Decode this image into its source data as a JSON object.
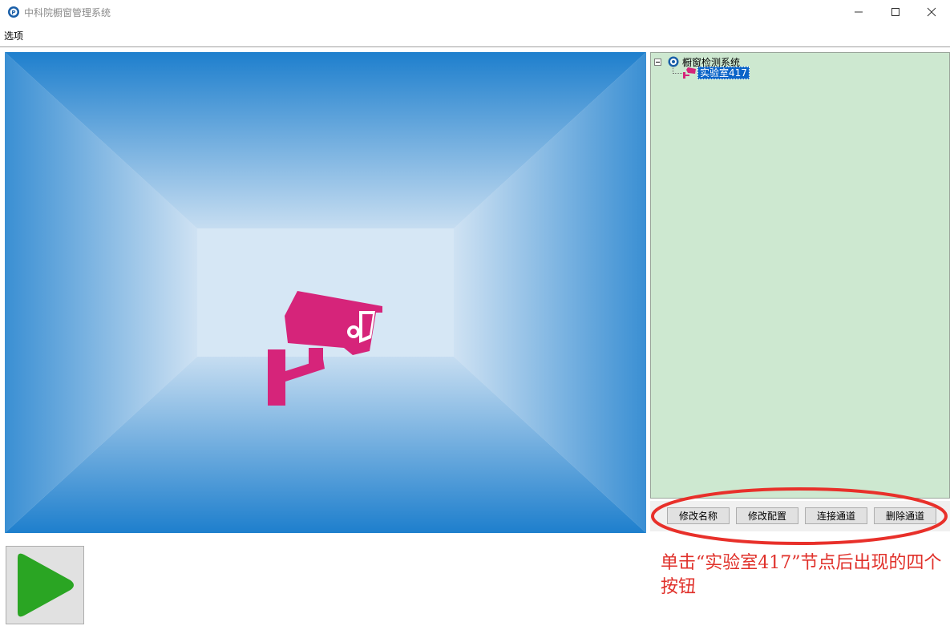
{
  "window": {
    "title": "中科院橱窗管理系统",
    "app_icon": "app-logo-icon",
    "controls": [
      "minimize-icon",
      "maximize-icon",
      "close-icon"
    ]
  },
  "menu": {
    "items": [
      {
        "label": "选项"
      }
    ]
  },
  "video": {
    "placeholder_icon": "security-camera-icon",
    "camera_color": "#d6247a"
  },
  "tree": {
    "root": {
      "label": "橱窗检测系统",
      "icon": "system-logo-icon",
      "expanded": true
    },
    "children": [
      {
        "label": "实验室417",
        "icon": "camera-icon",
        "selected": true
      }
    ],
    "background": "#cde8d0"
  },
  "buttons": {
    "rename": "修改名称",
    "config": "修改配置",
    "connect": "连接通道",
    "delete": "删除通道"
  },
  "annotation": {
    "text": "单击“实验室417”节点后出现的四个按钮",
    "color": "#e0302a"
  },
  "play": {
    "icon": "play-icon",
    "color": "#2aa523"
  }
}
